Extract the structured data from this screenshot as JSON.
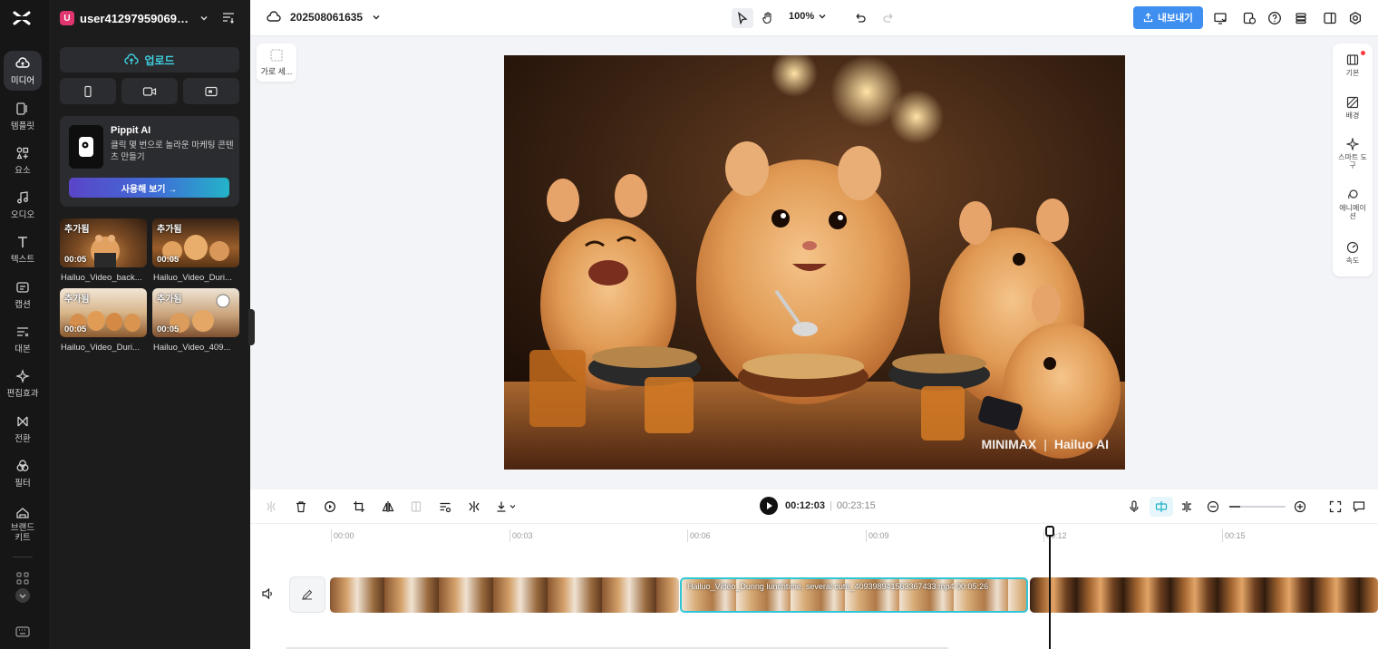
{
  "app": {
    "logo": "capcut-logo"
  },
  "rail": {
    "items": [
      {
        "label": "미디어",
        "icon": "cloud-media-icon",
        "active": true
      },
      {
        "label": "템플릿",
        "icon": "template-icon"
      },
      {
        "label": "요소",
        "icon": "elements-icon"
      },
      {
        "label": "오디오",
        "icon": "music-note-icon"
      },
      {
        "label": "텍스트",
        "icon": "text-t-icon"
      },
      {
        "label": "캡션",
        "icon": "caption-icon"
      },
      {
        "label": "대본",
        "icon": "script-icon"
      },
      {
        "label": "편집효과",
        "icon": "sparkle-icon"
      },
      {
        "label": "전환",
        "icon": "transition-icon"
      },
      {
        "label": "필터",
        "icon": "filter-icon"
      },
      {
        "label": "브랜드\n키트",
        "icon": "brand-kit-icon"
      }
    ]
  },
  "panel": {
    "user_initial": "U",
    "username": "user412979590691...",
    "upload_label": "업로드",
    "promo": {
      "title": "Pippit AI",
      "description": "클릭 몇 번으로 놀라운 마케팅 콘텐츠 만들기",
      "cta": "사용해 보기 →"
    },
    "media": [
      {
        "badge": "추가됨",
        "duration": "00:05",
        "name": "Hailuo_Video_back..."
      },
      {
        "badge": "추가됨",
        "duration": "00:05",
        "name": "Hailuo_Video_Duri..."
      },
      {
        "badge": "추가됨",
        "duration": "00:05",
        "name": "Hailuo_Video_Duri..."
      },
      {
        "badge": "추가됨",
        "duration": "00:05",
        "name": "Hailuo_Video_409..."
      }
    ]
  },
  "topbar": {
    "project_name": "202508061635",
    "zoom": "100%",
    "export_label": "내보내기"
  },
  "canvas": {
    "aspect_button": "가로 세...",
    "watermark": {
      "left": "MINIMAX",
      "divider": "|",
      "right": "Hailuo AI"
    }
  },
  "right_panel": {
    "items": [
      {
        "label": "기본",
        "icon": "basic-film-icon",
        "dot": true
      },
      {
        "label": "배경",
        "icon": "background-icon"
      },
      {
        "label": "스마트 도구",
        "icon": "smart-tools-icon"
      },
      {
        "label": "애니메이션",
        "icon": "animation-icon"
      },
      {
        "label": "속도",
        "icon": "speed-icon"
      }
    ]
  },
  "timeline": {
    "current_time": "00:12:03",
    "separator": "|",
    "total_time": "00:23:15",
    "ticks": [
      "00:00",
      "00:03",
      "00:06",
      "00:09",
      "00:12",
      "00:15"
    ],
    "clips": [
      {
        "label": ""
      },
      {
        "label": "Hailuo_Video_During lunchtime, several cute_409398941563367433.mp4  00:05:26",
        "selected": true
      },
      {
        "label": ""
      }
    ]
  }
}
